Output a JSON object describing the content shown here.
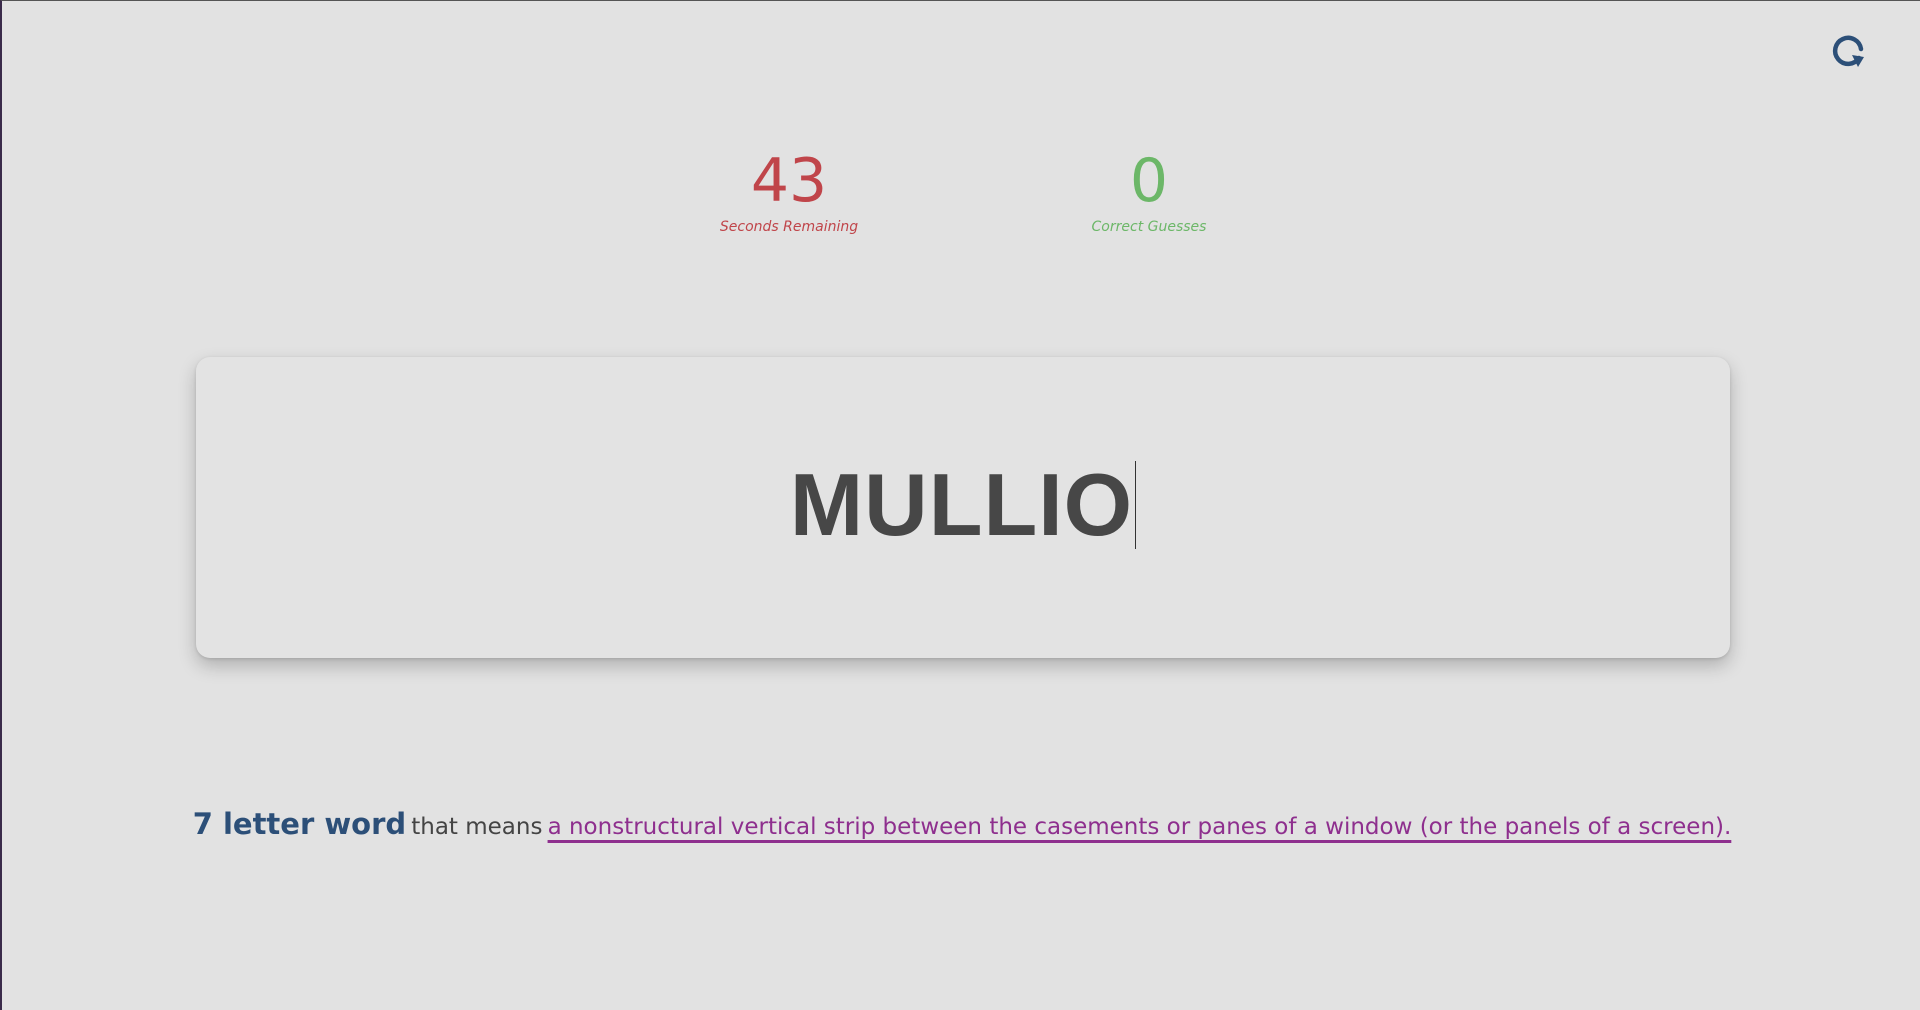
{
  "header": {
    "reset_icon": "reload-icon",
    "accent_color": "#2c4f78"
  },
  "stats": {
    "seconds_remaining": {
      "value": "43",
      "label": "Seconds Remaining",
      "color": "#c0454a"
    },
    "correct_guesses": {
      "value": "0",
      "label": "Correct Guesses",
      "color": "#6cb768"
    }
  },
  "guess": {
    "current_text": "MULLIO"
  },
  "clue": {
    "length_text": "7 letter word",
    "connector_text": "that means",
    "definition_text": "a nonstructural vertical strip between the casements or panes of a window (or the panels of a screen).",
    "definition_color": "#8e2f8e"
  }
}
